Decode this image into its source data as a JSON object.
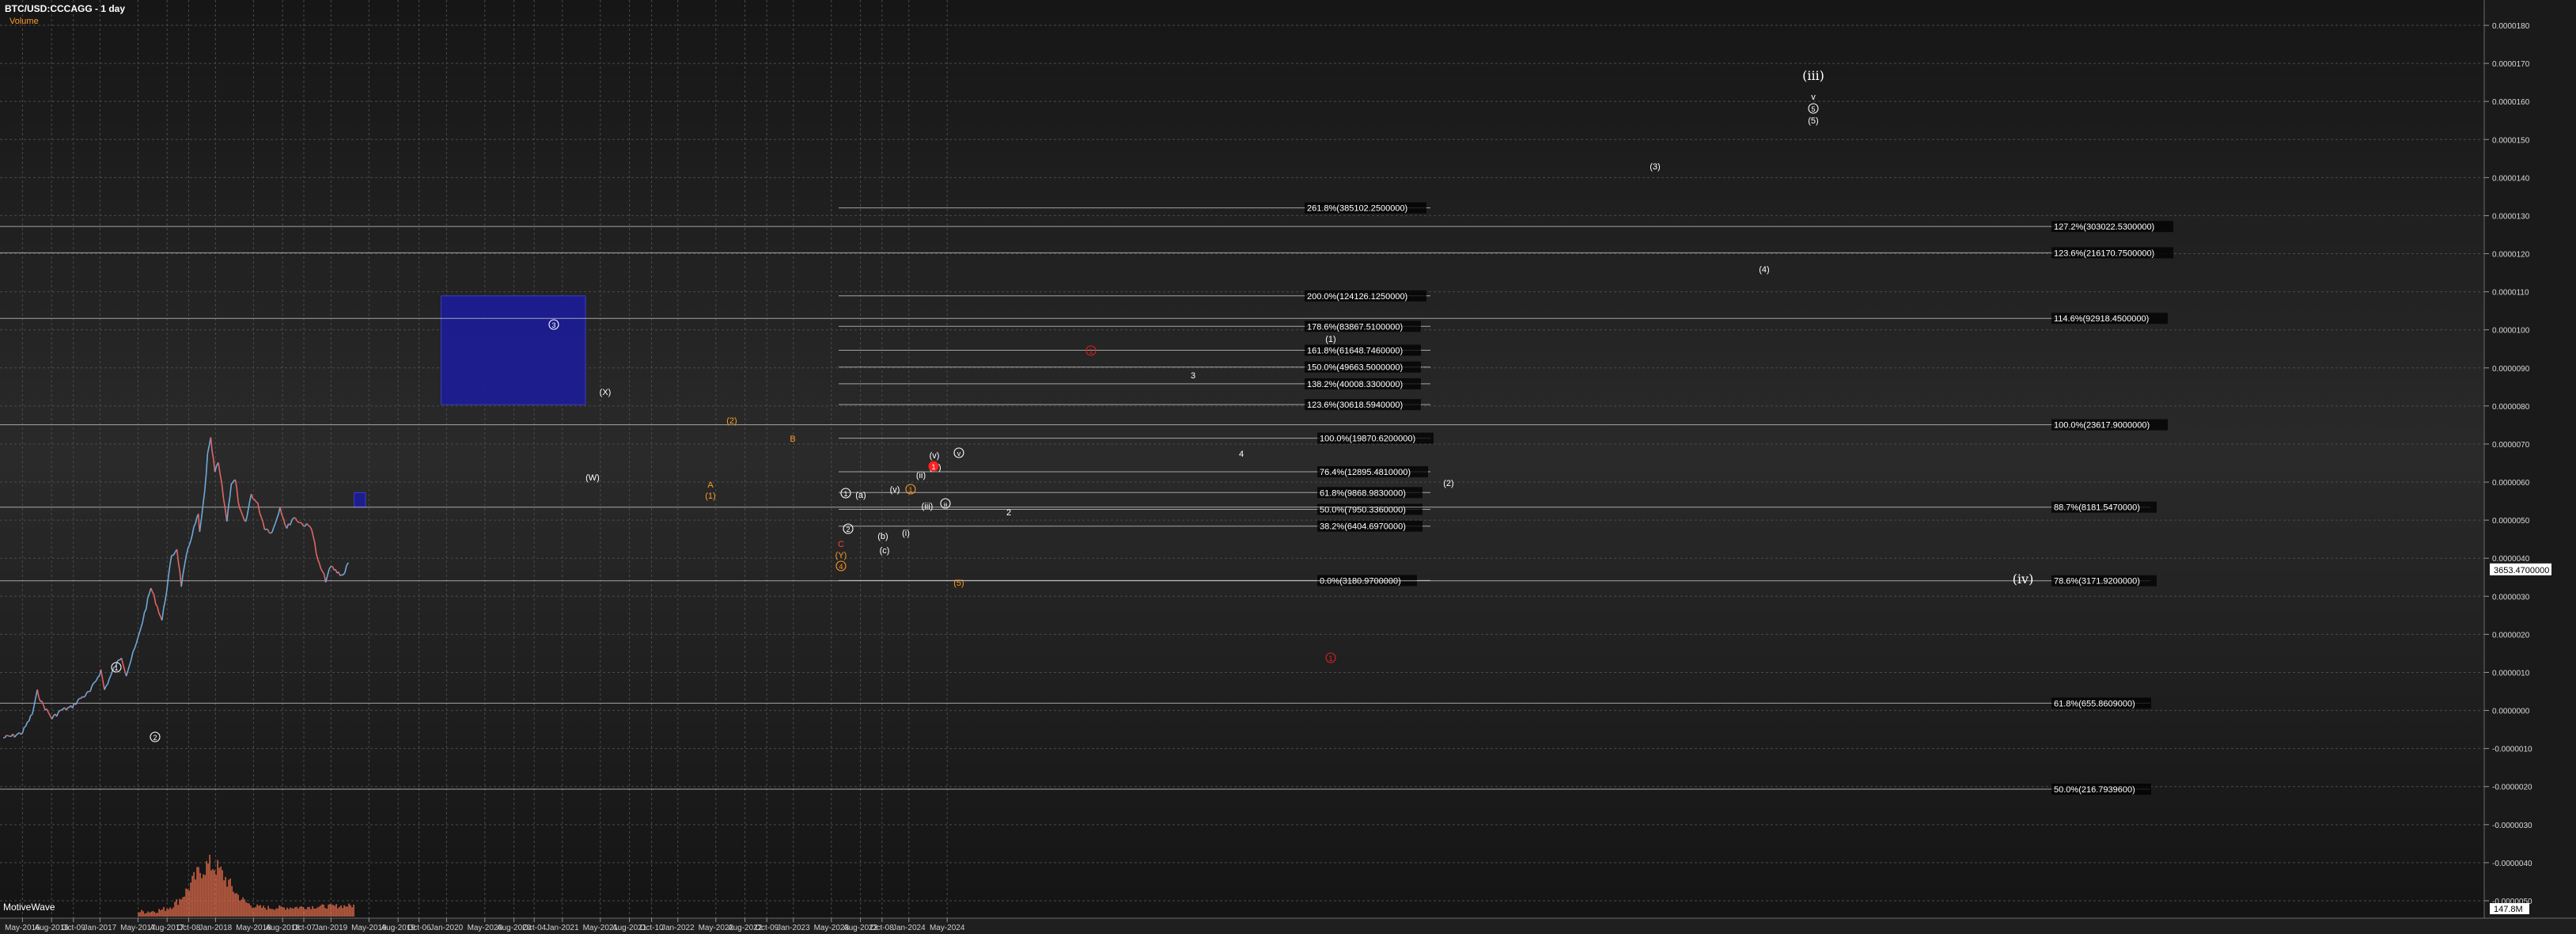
{
  "header": {
    "symbol": "BTC/USD:CCCAGG - 1 day",
    "indicator": "Volume"
  },
  "watermark": "MotiveWave",
  "chart_data": {
    "type": "line",
    "title": "BTC/USD:CCCAGG - 1 day",
    "scale": "log",
    "price_axis": {
      "range": [
        1,
        180000
      ],
      "tick_labels": [
        "0.0000180",
        "0.0000170",
        "0.0000160",
        "0.0000150",
        "0.0000140",
        "0.0000130",
        "0.0000120",
        "0.0000110",
        "0.0000100",
        "0.0000090",
        "0.0000080",
        "0.0000070",
        "0.0000060",
        "0.0000050",
        "0.0000040",
        "0.0000030",
        "0.0000020",
        "0.0000010",
        "0.0000000",
        "-0.0000010",
        "-0.0000020",
        "-0.0000030",
        "-0.0000040",
        "-0.0000050"
      ],
      "current_price_label": "3653.4700000",
      "volume_label": "147.8M"
    },
    "time_axis": {
      "labels": [
        "May-2016",
        "Aug-2016",
        "Oct-09",
        "Jan-2017",
        "May-2017",
        "Aug-2017",
        "Oct-08",
        "Jan-2018",
        "May-2018",
        "Aug-2018",
        "Oct-07",
        "Jan-2019",
        "May-2019",
        "Aug-2019",
        "Oct-06",
        "Jan-2020",
        "May-2020",
        "Aug-2020",
        "Oct-04",
        "Jan-2021",
        "May-2021",
        "Aug-2021",
        "Oct-10",
        "Jan-2022",
        "May-2022",
        "Aug-2022",
        "Oct-09",
        "Jan-2023",
        "May-2023",
        "Aug-2023",
        "Oct-08",
        "Jan-2024",
        "May-2024"
      ]
    },
    "price_series": {
      "name": "",
      "x": [
        "2016-03-01",
        "2016-04-01",
        "2016-05-01",
        "2016-06-01",
        "2016-06-17",
        "2016-07-01",
        "2016-08-02",
        "2016-09-01",
        "2016-10-01",
        "2016-11-01",
        "2016-12-01",
        "2017-01-04",
        "2017-01-15",
        "2017-02-15",
        "2017-03-10",
        "2017-03-25",
        "2017-05-01",
        "2017-06-11",
        "2017-07-16",
        "2017-08-15",
        "2017-09-01",
        "2017-09-15",
        "2017-10-01",
        "2017-10-20",
        "2017-11-08",
        "2017-11-12",
        "2017-11-28",
        "2017-12-07",
        "2017-12-17",
        "2017-12-30",
        "2018-01-10",
        "2018-02-06",
        "2018-02-20",
        "2018-03-05",
        "2018-03-18",
        "2018-04-06",
        "2018-04-24",
        "2018-05-15",
        "2018-06-05",
        "2018-06-29",
        "2018-07-24",
        "2018-08-14",
        "2018-09-05",
        "2018-10-01",
        "2018-11-01",
        "2018-11-20",
        "2018-12-15",
        "2019-01-01",
        "2019-01-20",
        "2019-02-08",
        "2019-02-25"
      ],
      "y": [
        420,
        430,
        450,
        570,
        760,
        660,
        540,
        600,
        620,
        700,
        760,
        1000,
        780,
        1030,
        1200,
        950,
        1500,
        2900,
        1900,
        4300,
        4800,
        3000,
        4300,
        5900,
        7400,
        5800,
        10000,
        16000,
        19500,
        12800,
        14500,
        6900,
        11200,
        11500,
        7900,
        6600,
        9700,
        8400,
        6300,
        5900,
        8200,
        6200,
        7200,
        6600,
        6300,
        4100,
        3200,
        3800,
        3550,
        3400,
        4000
      ]
    },
    "volume_series": {
      "name": "Volume",
      "max": 147800000
    },
    "fib_levels": [
      {
        "label": "261.8%(385102.2500000)",
        "price": 385102.25,
        "group": "upper"
      },
      {
        "label": "200.0%(124126.1250000)",
        "price": 124126.125,
        "group": "upper"
      },
      {
        "label": "178.6%(83867.5100000)",
        "price": 83867.51,
        "group": "upper"
      },
      {
        "label": "161.8%(61648.7460000)",
        "price": 61648.746,
        "group": "upper"
      },
      {
        "label": "150.0%(49663.5000000)",
        "price": 49663.5,
        "group": "upper"
      },
      {
        "label": "138.2%(40008.3300000)",
        "price": 40008.33,
        "group": "upper"
      },
      {
        "label": "123.6%(30618.5940000)",
        "price": 30618.594,
        "group": "upper"
      },
      {
        "label": "100.0%(19870.6200000)",
        "price": 19870.62,
        "group": "mid"
      },
      {
        "label": "76.4%(12895.4810000)",
        "price": 12895.481,
        "group": "mid"
      },
      {
        "label": "61.8%(9868.9830000)",
        "price": 9868.983,
        "group": "mid"
      },
      {
        "label": "50.0%(7950.3360000)",
        "price": 7950.336,
        "group": "mid"
      },
      {
        "label": "38.2%(6404.6970000)",
        "price": 6404.697,
        "group": "mid"
      },
      {
        "label": "0.0%(3180.9700000)",
        "price": 3180.97,
        "group": "mid"
      },
      {
        "label": "127.2%(303022.5300000)",
        "price": 303022.53,
        "group": "right"
      },
      {
        "label": "123.6%(216170.7500000)",
        "price": 216170.75,
        "group": "right"
      },
      {
        "label": "114.6%(92918.4500000)",
        "price": 92918.45,
        "group": "right"
      },
      {
        "label": "100.0%(23617.9000000)",
        "price": 23617.9,
        "group": "right"
      },
      {
        "label": "88.7%(8181.5470000)",
        "price": 8181.547,
        "group": "right"
      },
      {
        "label": "78.6%(3171.9200000)",
        "price": 3171.92,
        "group": "right"
      },
      {
        "label": "61.8%(655.8609000)",
        "price": 655.8609,
        "group": "right"
      },
      {
        "label": "50.0%(216.7939600)",
        "price": 216.79396,
        "group": "right"
      }
    ],
    "target_zones": [
      {
        "x_from": "2019-12-15",
        "x_to": "2021-03-15",
        "price_from": 30618.594,
        "price_to": 124126.125,
        "color": "#1c1c96"
      },
      {
        "x_from": "2019-03-15",
        "x_to": "2019-04-20",
        "price_from": 8181.547,
        "price_to": 9868.983,
        "color": "#1c1c96"
      }
    ],
    "wave_labels": [
      {
        "text": "1",
        "date": "2016-06-17",
        "price": 760,
        "style": "circle",
        "color": "#ffffff"
      },
      {
        "text": "2",
        "date": "2016-08-02",
        "price": 540,
        "style": "circle",
        "color": "#ffffff"
      },
      {
        "text": "3",
        "date": "2017-12-17",
        "price": 19500,
        "style": "circle",
        "color": "#ffffff"
      },
      {
        "text": "(W)",
        "date": "2018-02-06",
        "price": 6900,
        "style": "plain",
        "color": "#ffffff"
      },
      {
        "text": "(X)",
        "date": "2018-03-05",
        "price": 11500,
        "style": "plain",
        "color": "#ffffff"
      },
      {
        "text": "(2)",
        "date": "2018-07-24",
        "price": 8200,
        "style": "plain",
        "color": "#ff9a2a"
      },
      {
        "text": "A",
        "date": "2018-06-29",
        "price": 5900,
        "style": "plain",
        "color": "#ff9a2a"
      },
      {
        "text": "(1)",
        "date": "2018-06-29",
        "price": 5900,
        "style": "plain",
        "color": "#ff9a2a"
      },
      {
        "text": "B",
        "date": "2018-09-05",
        "price": 7200,
        "style": "plain",
        "color": "#ff9a2a"
      },
      {
        "text": "C",
        "date": "2018-12-15",
        "price": 3200,
        "style": "plain",
        "color": "#ff4040"
      },
      {
        "text": "(Y)",
        "date": "2018-12-15",
        "price": 3200,
        "style": "plain",
        "color": "#ff9a2a"
      },
      {
        "text": "4",
        "date": "2018-12-15",
        "price": 3200,
        "style": "circle",
        "color": "#ff9a2a"
      },
      {
        "text": "1",
        "date": "2018-12-24",
        "price": 4000,
        "style": "circle",
        "color": "#ffffff"
      },
      {
        "text": "(a)",
        "date": "2018-12-24",
        "price": 4000,
        "style": "plain",
        "color": "#ffffff"
      },
      {
        "text": "(b)",
        "date": "2019-01-03",
        "price": 4000,
        "style": "plain",
        "color": "#ffffff"
      },
      {
        "text": "(c)",
        "date": "2019-01-30",
        "price": 3400,
        "style": "plain",
        "color": "#ffffff"
      },
      {
        "text": "2",
        "date": "2019-02-08",
        "price": 3400,
        "style": "circle",
        "color": "#ffffff"
      },
      {
        "text": "(i)",
        "date": "2019-01-25",
        "price": 3550,
        "style": "plain",
        "color": "#ffffff"
      },
      {
        "text": "(ii)",
        "date": "2019-02-08",
        "price": 3400,
        "style": "plain",
        "color": "#ffffff"
      },
      {
        "text": "(iii)",
        "date": "2019-02-25",
        "price": 4000,
        "style": "plain",
        "color": "#ffffff"
      },
      {
        "text": "(iv)",
        "date": "2019-02-25",
        "price": 4000,
        "style": "plain",
        "color": "#ffffff"
      },
      {
        "text": "(v)",
        "date": "2019-03-05",
        "price": 4000,
        "style": "plain",
        "color": "#ffffff"
      },
      {
        "text": "1",
        "date": "2019-02-25",
        "price": 4000,
        "style": "circle",
        "color": "#ff9a2a"
      },
      {
        "text": "1",
        "date": "2019-03-05",
        "price": 4000,
        "style": "filled",
        "color": "#ff2020"
      },
      {
        "text": "(v)",
        "date": "2019-04-01",
        "price": 4000,
        "style": "plain",
        "color": "#ffffff"
      },
      {
        "text": "iii",
        "date": "2019-04-01",
        "price": 4000,
        "style": "circle",
        "color": "#ffffff"
      },
      {
        "text": "v",
        "date": "2019-04-01",
        "price": 4000,
        "style": "circle",
        "color": "#ffffff"
      },
      {
        "text": "2",
        "date": "2019-06-01",
        "price": 4000,
        "style": "plain",
        "color": "#ffffff"
      },
      {
        "text": "(5)",
        "date": "2019-05-01",
        "price": 4000,
        "style": "plain",
        "color": "#ff9a2a"
      },
      {
        "text": "3",
        "date": "2020-03-01",
        "price": 4000,
        "style": "plain",
        "color": "#ffffff"
      },
      {
        "text": "4",
        "date": "2020-04-01",
        "price": 4000,
        "style": "plain",
        "color": "#ffffff"
      },
      {
        "text": "(1)",
        "date": "2020-06-01",
        "price": 4000,
        "style": "plain",
        "color": "#ffffff"
      },
      {
        "text": "(2)",
        "date": "2020-12-01",
        "price": 4000,
        "style": "plain",
        "color": "#ffffff"
      },
      {
        "text": "(3)",
        "date": "2021-06-01",
        "price": 4000,
        "style": "plain",
        "color": "#ffffff"
      },
      {
        "text": "(4)",
        "date": "2021-12-01",
        "price": 4000,
        "style": "plain",
        "color": "#ffffff"
      },
      {
        "text": "(iii)",
        "date": "2022-04-01",
        "price": 4000,
        "style": "plain",
        "color": "#ffffff"
      },
      {
        "text": "v",
        "date": "2022-04-01",
        "price": 4000,
        "style": "plain",
        "color": "#ffffff"
      },
      {
        "text": "5",
        "date": "2022-04-01",
        "price": 4000,
        "style": "circle",
        "color": "#ffffff"
      },
      {
        "text": "(5)",
        "date": "2022-04-01",
        "price": 4000,
        "style": "plain",
        "color": "#ffffff"
      },
      {
        "text": "(iv)",
        "date": "2023-01-01",
        "price": 4000,
        "style": "plain",
        "color": "#ffffff"
      },
      {
        "text": "1",
        "date": "2019-10-01",
        "price": 4000,
        "style": "circle",
        "color": "#e02020"
      },
      {
        "text": "1",
        "date": "2020-08-01",
        "price": 4000,
        "style": "circle",
        "color": "#e02020"
      }
    ],
    "colors": {
      "background": "#000000",
      "price_up": "#6fa8dc",
      "price_down": "#e06666",
      "volume": "#e06a4a",
      "fib_line": "#cfcfcf",
      "grid": "#4a4a4a",
      "zone": "#1c1c96",
      "label_orange": "#ff9a2a",
      "label_red": "#ff3030"
    },
    "grid": true,
    "legend": "none"
  }
}
